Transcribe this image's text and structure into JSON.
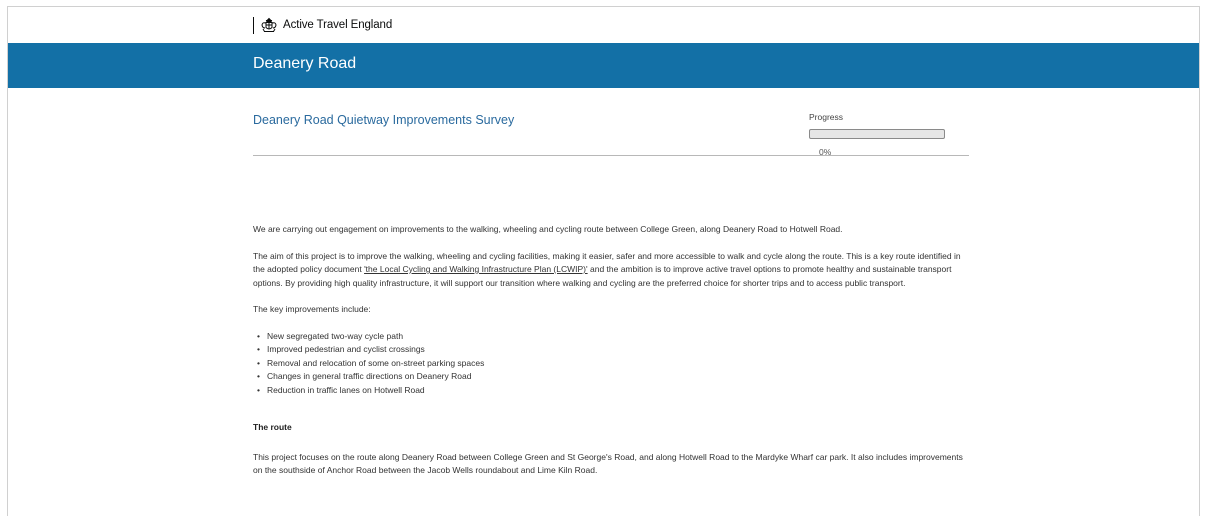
{
  "brand": {
    "name": "Active Travel England",
    "icon": "royal-crest-icon"
  },
  "header": {
    "title": "Deanery Road",
    "color": "#1370a6"
  },
  "survey": {
    "title": "Deanery Road Quietway Improvements Survey",
    "progress_label": "Progress",
    "progress_percent": 0,
    "progress_text": "0%"
  },
  "body": {
    "intro": "We are carrying out engagement on improvements to the walking, wheeling and cycling route between College Green, along Deanery Road to Hotwell Road.",
    "aim_before": "The aim of this project is to improve the walking, wheeling and cycling facilities, making it easier, safer and more accessible to walk and cycle along the route. This is a key route identified in the adopted policy document ",
    "aim_link": "'the Local Cycling and Walking Infrastructure Plan (LCWIP)'",
    "aim_after": " and the ambition is to improve active travel options to promote healthy and sustainable transport options. By providing high quality infrastructure, it will support our transition where walking and cycling are the preferred choice for shorter trips and to access public transport.",
    "key_intro": "The key improvements include:",
    "improvements": [
      "New segregated two-way cycle path",
      "Improved pedestrian and cyclist crossings",
      "Removal and relocation of some on-street parking spaces",
      "Changes in general traffic directions on Deanery Road",
      "Reduction in traffic lanes on Hotwell Road"
    ],
    "route_heading": "The route",
    "route_text": "This project focuses on the route along Deanery Road between College Green and St George's Road, and along Hotwell Road to the Mardyke Wharf car park. It also includes improvements on the southside of Anchor Road between the Jacob Wells roundabout and Lime Kiln Road."
  }
}
